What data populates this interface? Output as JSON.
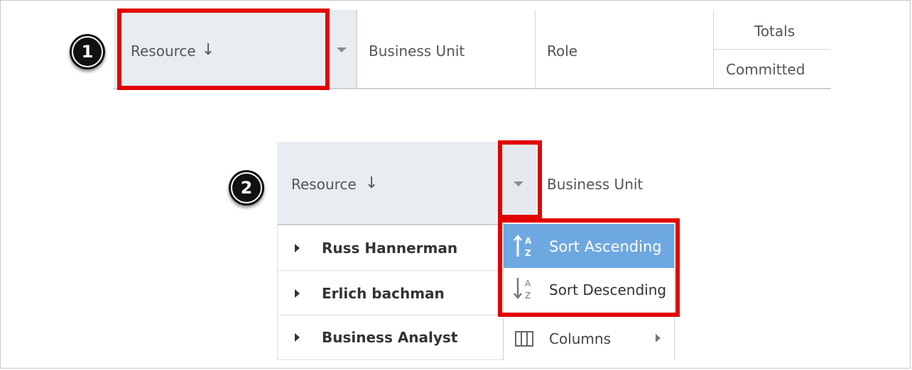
{
  "step1": {
    "badge": "1",
    "headers": {
      "resource": "Resource",
      "sort_arrow": "↓",
      "business_unit": "Business Unit",
      "role": "Role",
      "totals": "Totals",
      "committed": "Committed"
    }
  },
  "step2": {
    "badge": "2",
    "headers": {
      "resource": "Resource",
      "sort_arrow": "↓",
      "business_unit": "Business Unit"
    },
    "rows": [
      {
        "label": "Russ Hannerman"
      },
      {
        "label": "Erlich bachman"
      },
      {
        "label": "Business Analyst"
      }
    ],
    "menu": {
      "sort_ascending": "Sort Ascending",
      "sort_descending": "Sort Descending",
      "columns": "Columns"
    }
  },
  "colors": {
    "highlight_red": "#e30000",
    "header_bg": "#e8edf2",
    "menu_selected_bg": "#6ea8e0"
  }
}
